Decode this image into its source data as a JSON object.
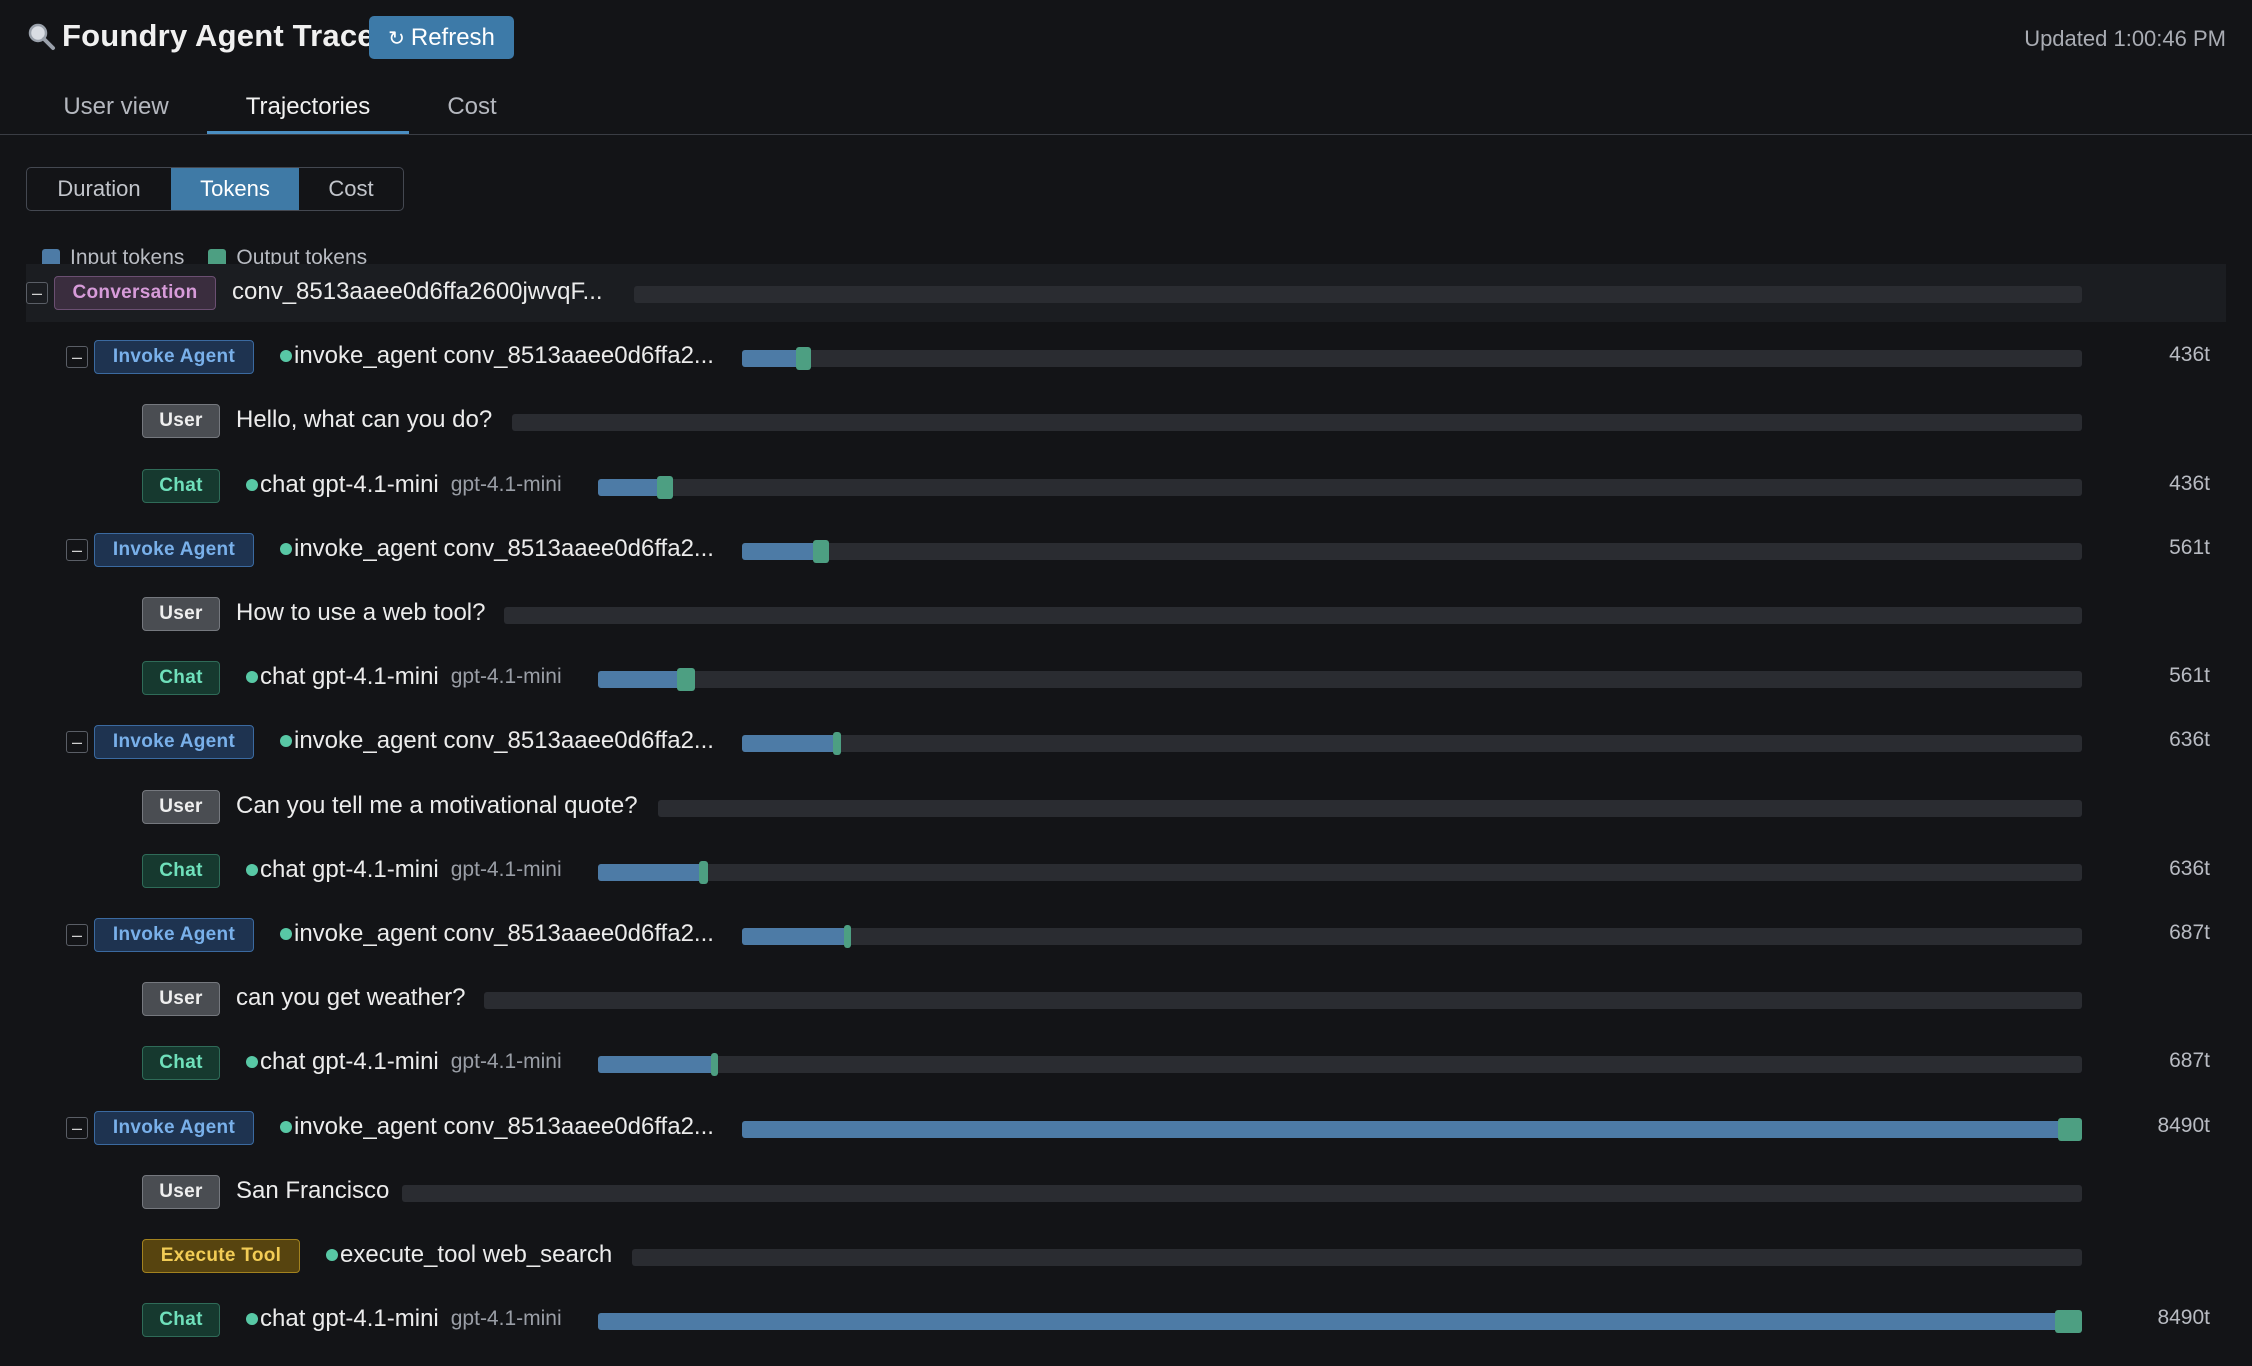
{
  "header": {
    "title": "Foundry Agent Trace",
    "refresh_label": "Refresh",
    "refresh_icon": "↻",
    "updated": "Updated 1:00:46 PM"
  },
  "tabs": [
    {
      "label": "User view",
      "active": false
    },
    {
      "label": "Trajectories",
      "active": true
    },
    {
      "label": "Cost",
      "active": false
    }
  ],
  "segmented": [
    {
      "label": "Duration",
      "active": false
    },
    {
      "label": "Tokens",
      "active": true
    },
    {
      "label": "Cost",
      "active": false
    }
  ],
  "legend": [
    {
      "label": "Input tokens",
      "color": "#4d7ba6"
    },
    {
      "label": "Output tokens",
      "color": "#4d9f82"
    }
  ],
  "colors": {
    "accent": "#3d7aa8",
    "input_tokens": "#4d7ba6",
    "output_tokens": "#4d9f82"
  },
  "rows": [
    {
      "badge": "Conversation",
      "kind": "conv",
      "label": "conv_8513aaee0d6ffa2600jwvqF...",
      "collapsible": true,
      "dot": false,
      "model": "",
      "tokens": "",
      "input_frac": 0,
      "output_frac": 0
    },
    {
      "badge": "Invoke Agent",
      "kind": "agent",
      "label": "invoke_agent conv_8513aaee0d6ffa2...",
      "collapsible": true,
      "dot": true,
      "model": "",
      "tokens": "436t",
      "input_frac": 0.04,
      "output_frac": 0.011
    },
    {
      "badge": "User",
      "kind": "user",
      "label": "Hello, what can you do?",
      "collapsible": false,
      "dot": false,
      "model": "",
      "tokens": "",
      "input_frac": 0,
      "output_frac": 0
    },
    {
      "badge": "Chat",
      "kind": "chat",
      "label": "chat gpt-4.1-mini",
      "collapsible": false,
      "dot": true,
      "model": "gpt-4.1-mini",
      "tokens": "436t",
      "input_frac": 0.04,
      "output_frac": 0.011
    },
    {
      "badge": "Invoke Agent",
      "kind": "agent",
      "label": "invoke_agent conv_8513aaee0d6ffa2...",
      "collapsible": true,
      "dot": true,
      "model": "",
      "tokens": "561t",
      "input_frac": 0.053,
      "output_frac": 0.012
    },
    {
      "badge": "User",
      "kind": "user",
      "label": "How to use a web tool?",
      "collapsible": false,
      "dot": false,
      "model": "",
      "tokens": "",
      "input_frac": 0,
      "output_frac": 0
    },
    {
      "badge": "Chat",
      "kind": "chat",
      "label": "chat gpt-4.1-mini",
      "collapsible": false,
      "dot": true,
      "model": "gpt-4.1-mini",
      "tokens": "561t",
      "input_frac": 0.053,
      "output_frac": 0.012
    },
    {
      "badge": "Invoke Agent",
      "kind": "agent",
      "label": "invoke_agent conv_8513aaee0d6ffa2...",
      "collapsible": true,
      "dot": true,
      "model": "",
      "tokens": "636t",
      "input_frac": 0.068,
      "output_frac": 0.006
    },
    {
      "badge": "User",
      "kind": "user",
      "label": "Can you tell me a motivational quote?",
      "collapsible": false,
      "dot": false,
      "model": "",
      "tokens": "",
      "input_frac": 0,
      "output_frac": 0
    },
    {
      "badge": "Chat",
      "kind": "chat",
      "label": "chat gpt-4.1-mini",
      "collapsible": false,
      "dot": true,
      "model": "gpt-4.1-mini",
      "tokens": "636t",
      "input_frac": 0.068,
      "output_frac": 0.006
    },
    {
      "badge": "Invoke Agent",
      "kind": "agent",
      "label": "invoke_agent conv_8513aaee0d6ffa2...",
      "collapsible": true,
      "dot": true,
      "model": "",
      "tokens": "687t",
      "input_frac": 0.076,
      "output_frac": 0.005
    },
    {
      "badge": "User",
      "kind": "user",
      "label": "can you get weather?",
      "collapsible": false,
      "dot": false,
      "model": "",
      "tokens": "",
      "input_frac": 0,
      "output_frac": 0
    },
    {
      "badge": "Chat",
      "kind": "chat",
      "label": "chat gpt-4.1-mini",
      "collapsible": false,
      "dot": true,
      "model": "gpt-4.1-mini",
      "tokens": "687t",
      "input_frac": 0.076,
      "output_frac": 0.005
    },
    {
      "badge": "Invoke Agent",
      "kind": "agent",
      "label": "invoke_agent conv_8513aaee0d6ffa2...",
      "collapsible": true,
      "dot": true,
      "model": "",
      "tokens": "8490t",
      "input_frac": 0.982,
      "output_frac": 0.018
    },
    {
      "badge": "User",
      "kind": "user",
      "label": "San Francisco",
      "collapsible": false,
      "dot": false,
      "model": "",
      "tokens": "",
      "input_frac": 0,
      "output_frac": 0
    },
    {
      "badge": "Execute Tool",
      "kind": "tool",
      "label": "execute_tool web_search",
      "collapsible": false,
      "dot": true,
      "model": "",
      "tokens": "",
      "input_frac": 0,
      "output_frac": 0
    },
    {
      "badge": "Chat",
      "kind": "chat",
      "label": "chat gpt-4.1-mini",
      "collapsible": false,
      "dot": true,
      "model": "gpt-4.1-mini",
      "tokens": "8490t",
      "input_frac": 0.982,
      "output_frac": 0.018
    }
  ]
}
